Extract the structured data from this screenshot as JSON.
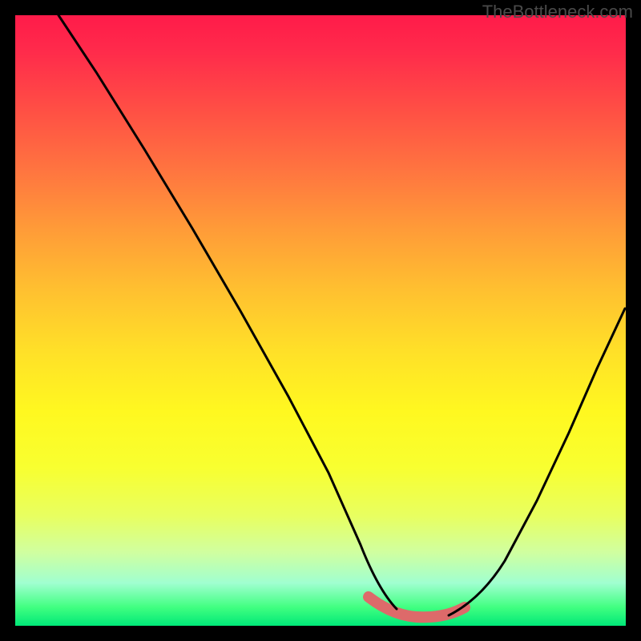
{
  "watermark": "TheBottleneck.com",
  "chart_data": {
    "type": "line",
    "title": "",
    "xlabel": "",
    "ylabel": "",
    "xlim": [
      0,
      100
    ],
    "ylim": [
      0,
      100
    ],
    "background_gradient": {
      "top_color": "#ff1b4a",
      "bottom_color": "#00e878",
      "direction": "vertical"
    },
    "series": [
      {
        "name": "bottleneck-curve",
        "x": [
          0,
          10,
          20,
          30,
          40,
          50,
          57,
          62,
          66,
          70,
          75,
          80,
          90,
          100
        ],
        "y": [
          100,
          85,
          67,
          50,
          34,
          18,
          6,
          1,
          0,
          0,
          2,
          9,
          28,
          50
        ],
        "color": "#000000"
      },
      {
        "name": "highlight-segment",
        "x": [
          58,
          62,
          66,
          70,
          73
        ],
        "y": [
          4,
          1,
          0,
          0,
          1
        ],
        "color": "#dd6a6a",
        "stroke_width": 10
      }
    ],
    "note": "Chart has no visible axes, tick labels, or numeric annotations. Values estimated from curve shape relative to plot bounds."
  }
}
